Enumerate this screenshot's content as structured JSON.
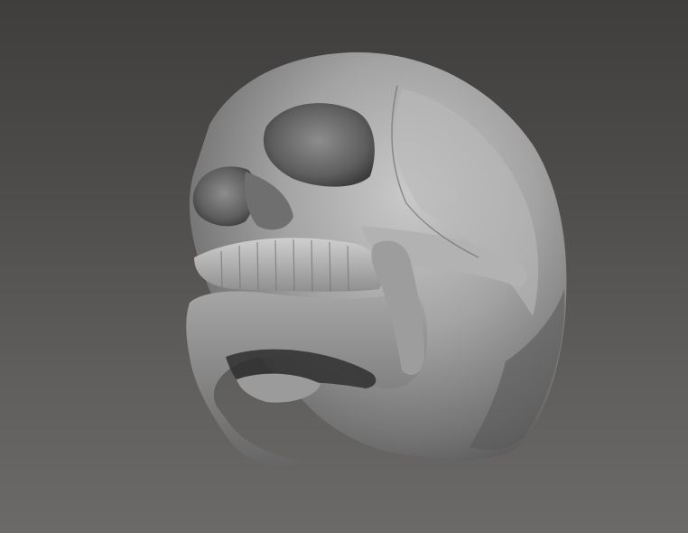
{
  "viewport": {
    "background_top": "#3f3e3d",
    "background_bottom": "#6b6a69",
    "model_name": "skull-sculpt",
    "material_color": "#9a9a9a"
  }
}
